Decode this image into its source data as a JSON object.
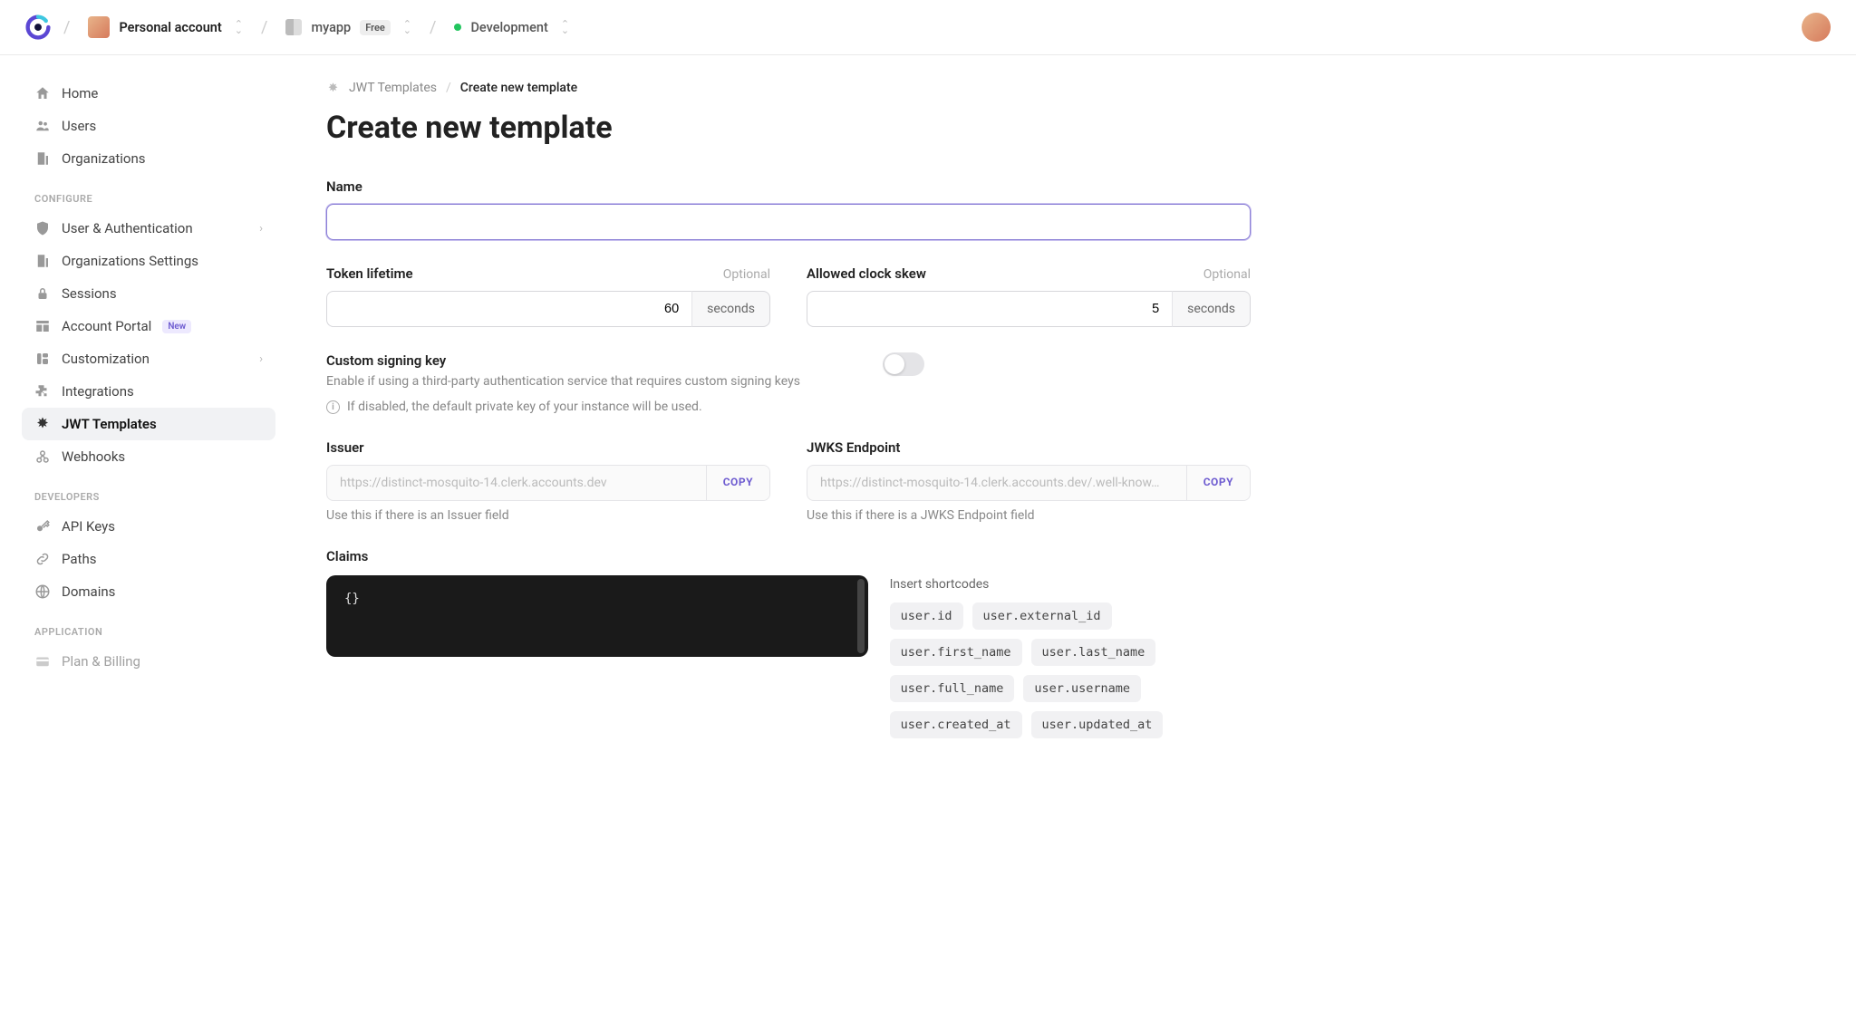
{
  "header": {
    "account_label": "Personal account",
    "app_name": "myapp",
    "app_plan": "Free",
    "environment": "Development"
  },
  "sidebar": {
    "top": [
      {
        "label": "Home"
      },
      {
        "label": "Users"
      },
      {
        "label": "Organizations"
      }
    ],
    "sections": [
      {
        "title": "CONFIGURE",
        "items": [
          {
            "label": "User & Authentication",
            "sub": true
          },
          {
            "label": "Organizations Settings"
          },
          {
            "label": "Sessions"
          },
          {
            "label": "Account Portal",
            "badge": "New"
          },
          {
            "label": "Customization",
            "sub": true
          },
          {
            "label": "Integrations"
          },
          {
            "label": "JWT Templates",
            "active": true
          },
          {
            "label": "Webhooks"
          }
        ]
      },
      {
        "title": "DEVELOPERS",
        "items": [
          {
            "label": "API Keys"
          },
          {
            "label": "Paths"
          },
          {
            "label": "Domains"
          }
        ]
      },
      {
        "title": "APPLICATION",
        "items": [
          {
            "label": "Plan & Billing"
          }
        ]
      }
    ]
  },
  "breadcrumb": {
    "root": "JWT Templates",
    "current": "Create new template"
  },
  "page_title": "Create new template",
  "form": {
    "name_label": "Name",
    "name_value": "",
    "token_lifetime": {
      "label": "Token lifetime",
      "optional": "Optional",
      "value": "60",
      "unit": "seconds"
    },
    "clock_skew": {
      "label": "Allowed clock skew",
      "optional": "Optional",
      "value": "5",
      "unit": "seconds"
    },
    "signing": {
      "label": "Custom signing key",
      "desc": "Enable if using a third-party authentication service that requires custom signing keys",
      "info": "If disabled, the default private key of your instance will be used."
    },
    "issuer": {
      "label": "Issuer",
      "value": "https://distinct-mosquito-14.clerk.accounts.dev",
      "copy": "COPY",
      "hint": "Use this if there is an Issuer field"
    },
    "jwks": {
      "label": "JWKS Endpoint",
      "value": "https://distinct-mosquito-14.clerk.accounts.dev/.well-know…",
      "copy": "COPY",
      "hint": "Use this if there is a JWKS Endpoint field"
    },
    "claims": {
      "label": "Claims",
      "content": "{}"
    },
    "shortcodes": {
      "label": "Insert shortcodes",
      "items": [
        "user.id",
        "user.external_id",
        "user.first_name",
        "user.last_name",
        "user.full_name",
        "user.username",
        "user.created_at",
        "user.updated_at"
      ]
    }
  }
}
